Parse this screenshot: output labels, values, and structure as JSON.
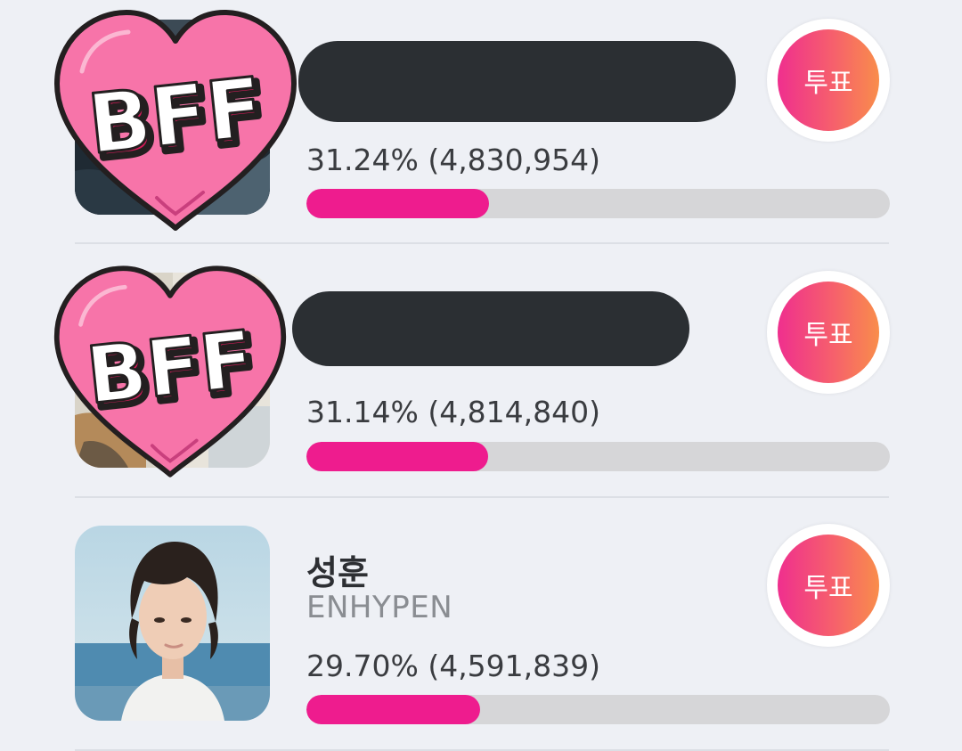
{
  "colors": {
    "background": "#eef0f5",
    "progress_fill": "#ee1c8e",
    "progress_track": "#d6d6d8",
    "vote_gradient_start": "#ef2f8e",
    "vote_gradient_end": "#f98d4b",
    "redaction": "#2b2f33",
    "heart_sticker": "#f774a9"
  },
  "entries": [
    {
      "name": "",
      "group": "",
      "percent_text": "31.24% (4,830,954)",
      "percent": 31.24,
      "votes": 4830954,
      "vote_label": "투표",
      "sticker_text": "BFF",
      "redacted": true
    },
    {
      "name": "",
      "group": "",
      "percent_text": "31.14% (4,814,840)",
      "percent": 31.14,
      "votes": 4814840,
      "vote_label": "투표",
      "sticker_text": "BFF",
      "redacted": true
    },
    {
      "name": "성훈",
      "group": "ENHYPEN",
      "percent_text": "29.70% (4,591,839)",
      "percent": 29.7,
      "votes": 4591839,
      "vote_label": "투표",
      "redacted": false
    }
  ]
}
